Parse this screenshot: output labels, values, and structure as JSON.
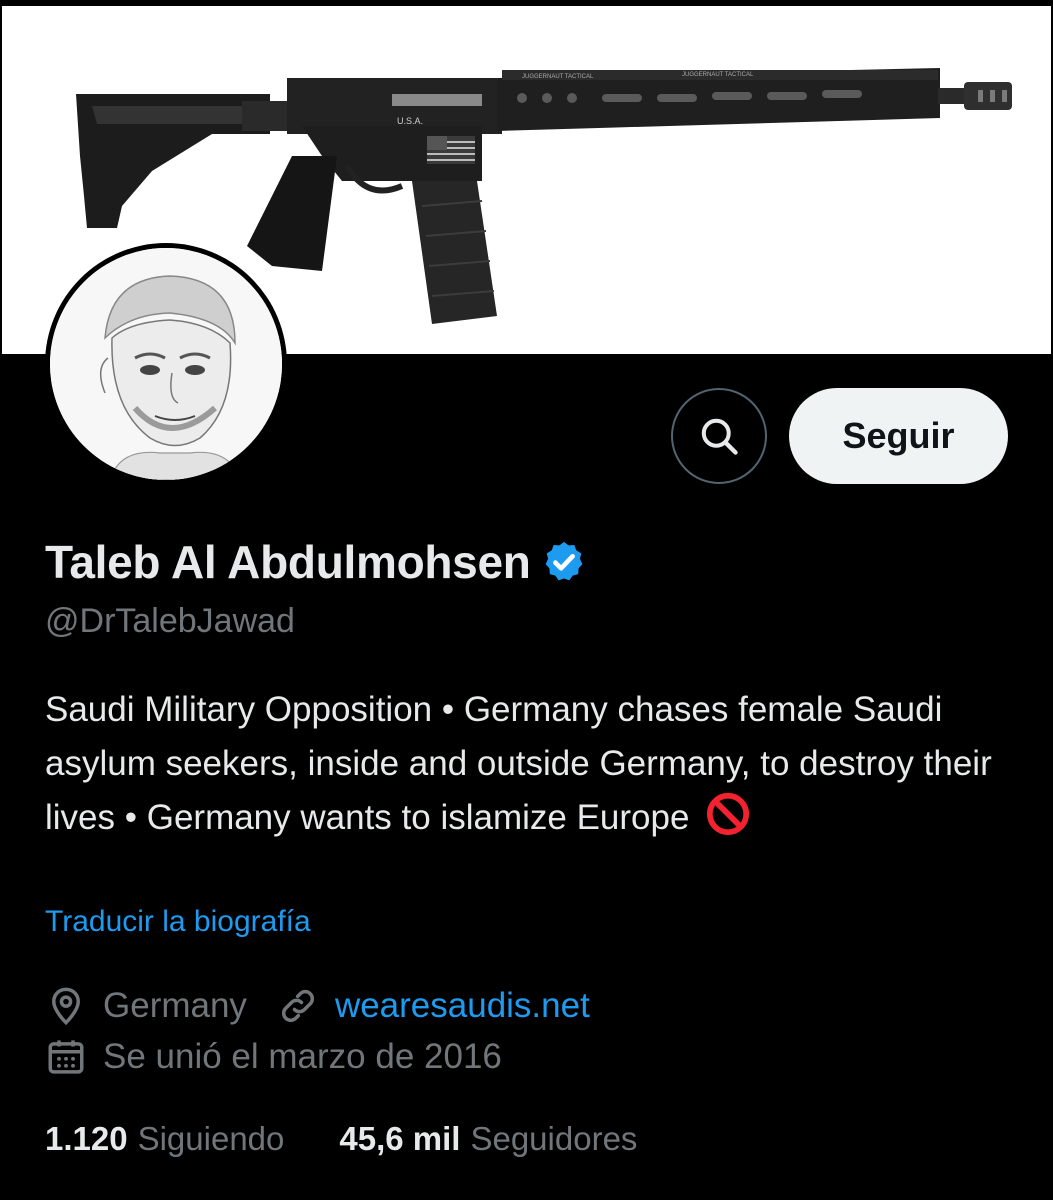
{
  "profile": {
    "display_name": "Taleb Al Abdulmohsen",
    "handle": "@DrTalebJawad",
    "bio": "Saudi Military Opposition • Germany chases female Saudi asylum seekers, inside and outside Germany, to destroy their lives • Germany wants to islamize Europe",
    "bio_emoji": "no-entry-emoji",
    "translate_label": "Traducir la biografía",
    "location": "Germany",
    "website": "wearesaudis.net",
    "joined": "Se unió el marzo de 2016",
    "verified_badge": "verified-badge-icon"
  },
  "banner_text": {
    "brand_left": "JUGGERNAUT TACTICAL",
    "brand_right": "JUGGERNAUT TACTICAL",
    "usa": "U.S.A."
  },
  "actions": {
    "search_icon": "search-icon",
    "follow_label": "Seguir"
  },
  "stats": {
    "following_count": "1.120",
    "following_label": "Siguiendo",
    "followers_count": "45,6 mil",
    "followers_label": "Seguidores"
  },
  "colors": {
    "background": "#000000",
    "text_primary": "#e7e9ea",
    "text_secondary": "#71767b",
    "accent_blue": "#1d9bf0",
    "button_light": "#eff3f4",
    "no_entry_red": "#f4212e"
  }
}
